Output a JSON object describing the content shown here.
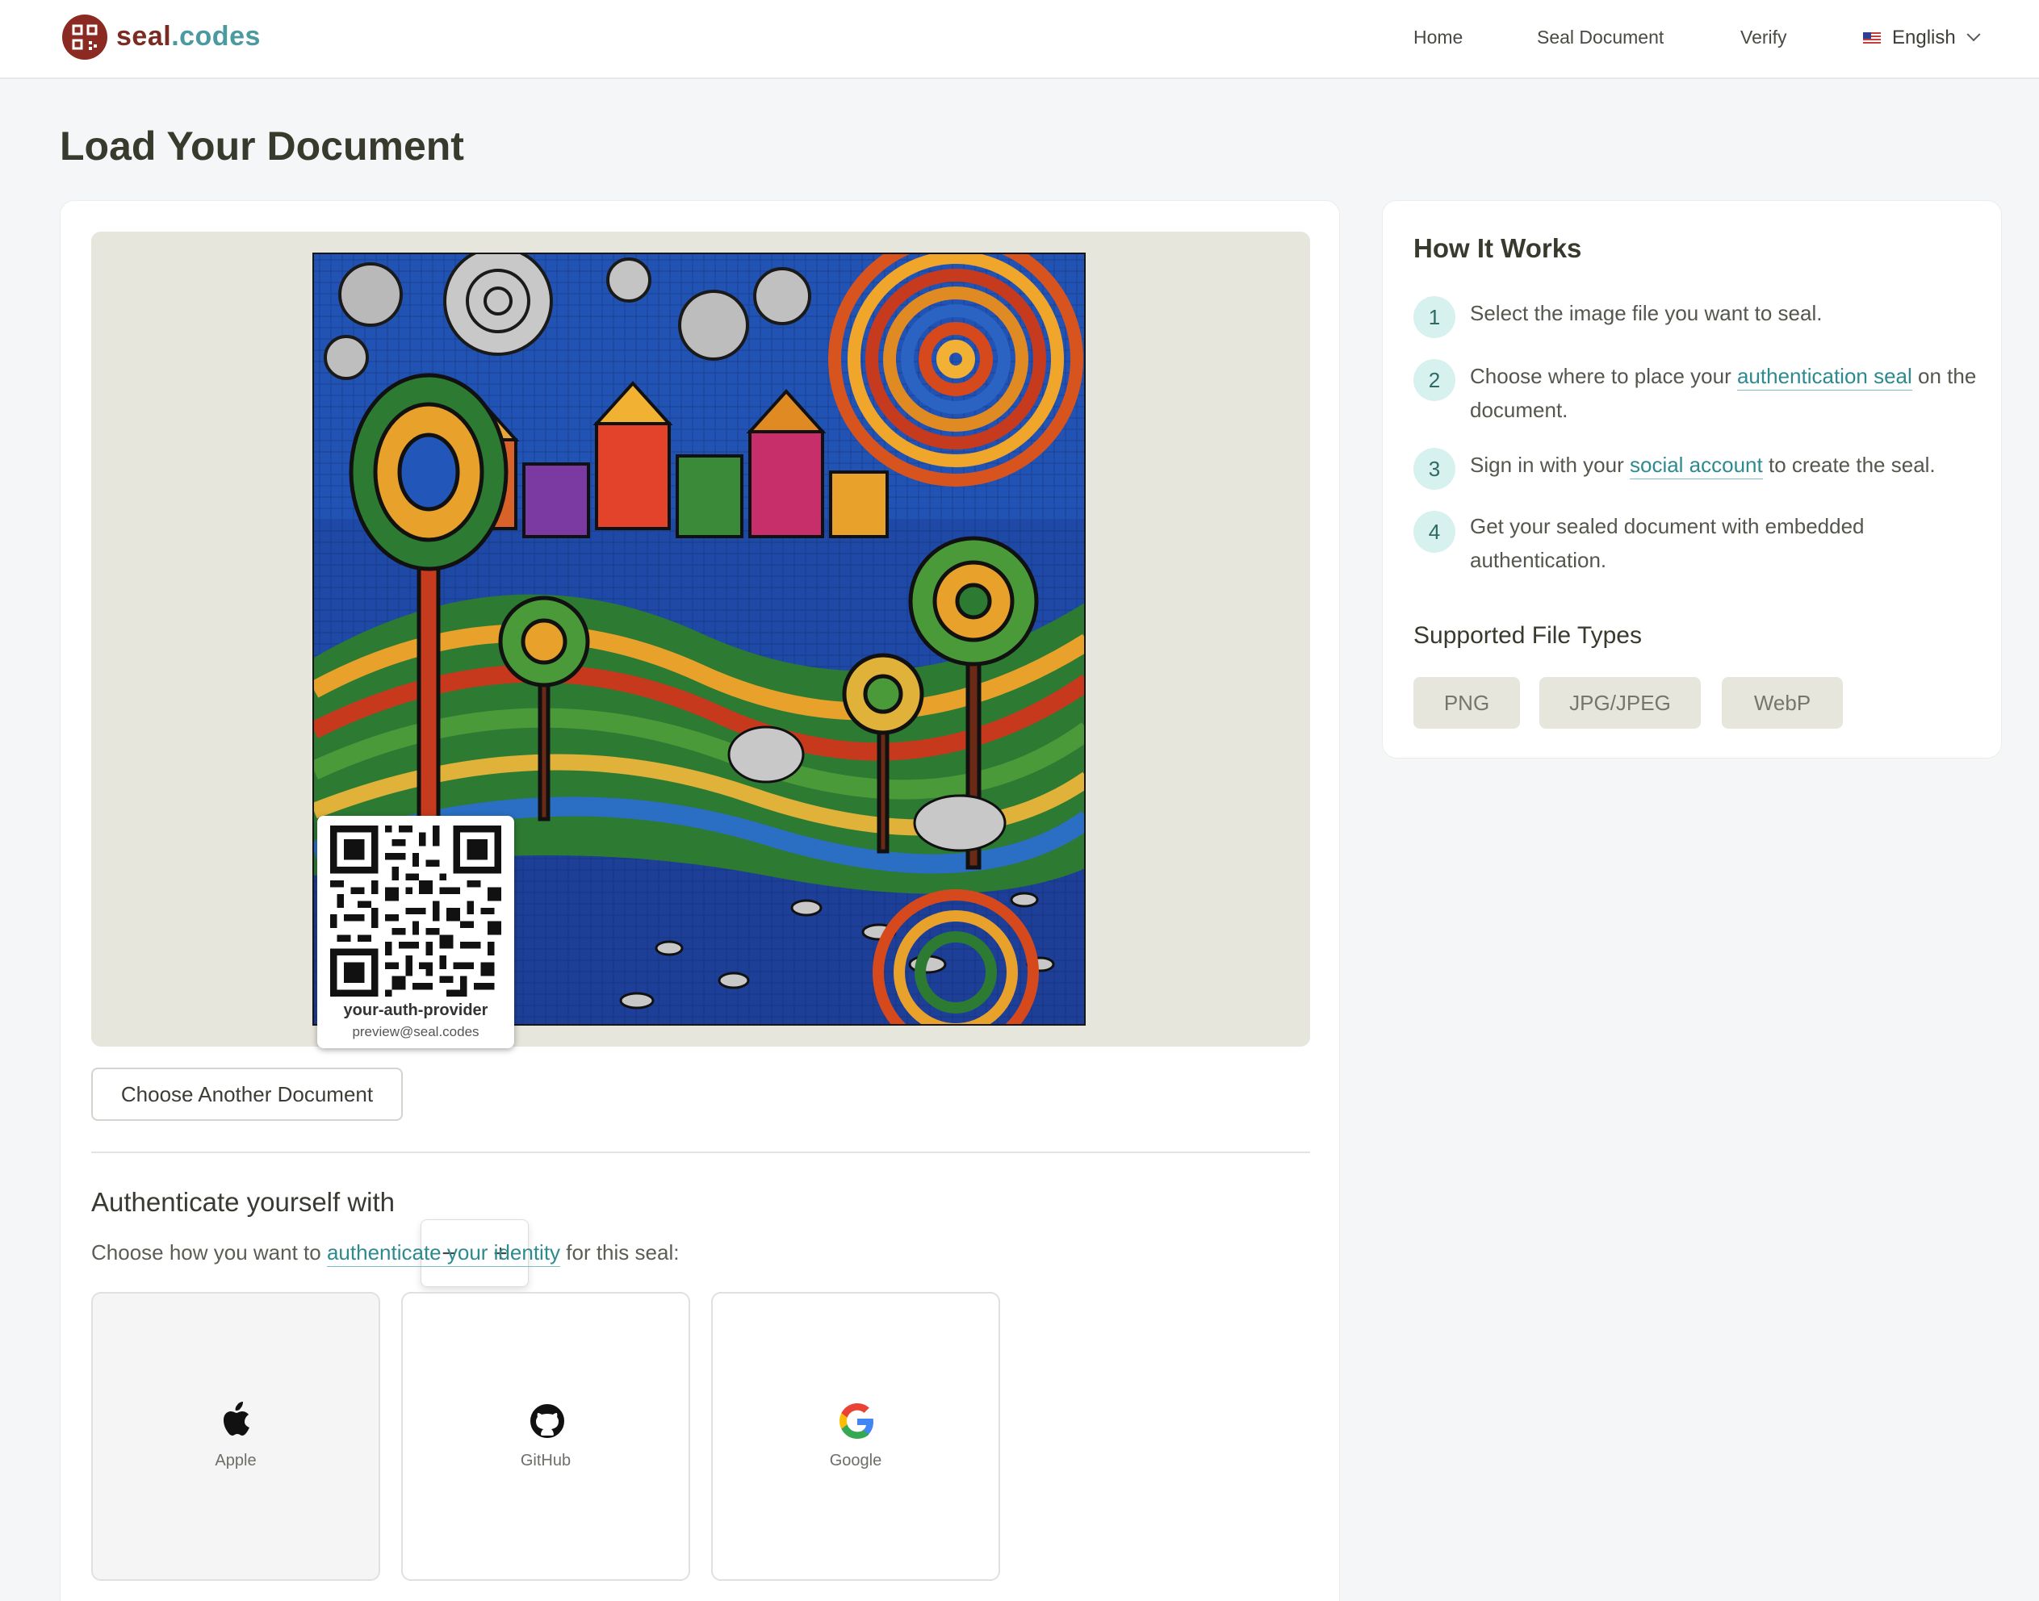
{
  "header": {
    "brand_main": "seal",
    "brand_suffix": ".codes",
    "nav": {
      "home": "Home",
      "seal_document": "Seal Document",
      "verify": "Verify"
    },
    "language": "English"
  },
  "page_title": "Load Your Document",
  "preview": {
    "qr_provider": "your-auth-provider",
    "qr_email": "preview@seal.codes",
    "zoom_out_label": "−",
    "zoom_in_label": "+"
  },
  "choose_another_label": "Choose Another Document",
  "auth": {
    "title": "Authenticate yourself with",
    "desc_before": "Choose how you want to ",
    "desc_link": "authenticate your identity",
    "desc_after": " for this seal:",
    "providers": [
      {
        "label": "Apple",
        "icon": "apple-icon",
        "selected": true
      },
      {
        "label": "GitHub",
        "icon": "github-icon",
        "selected": false
      },
      {
        "label": "Google",
        "icon": "google-icon",
        "selected": false
      }
    ]
  },
  "how_it_works": {
    "title": "How It Works",
    "steps": [
      {
        "num": "1",
        "before": "Select the image file you want to seal.",
        "link": "",
        "after": ""
      },
      {
        "num": "2",
        "before": "Choose where to place your ",
        "link": "authentication seal",
        "after": " on the document."
      },
      {
        "num": "3",
        "before": "Sign in with your ",
        "link": "social account",
        "after": " to create the seal."
      },
      {
        "num": "4",
        "before": "Get your sealed document with embedded authentication.",
        "link": "",
        "after": ""
      }
    ],
    "types_title": "Supported File Types",
    "types": [
      "PNG",
      "JPG/JPEG",
      "WebP"
    ]
  },
  "colors": {
    "brand_red": "#7c2b22",
    "brand_teal": "#4b9aa0",
    "link": "#2d8a8f",
    "step_badge": "#d6f1ee",
    "chip_bg": "#e6e6dc"
  }
}
